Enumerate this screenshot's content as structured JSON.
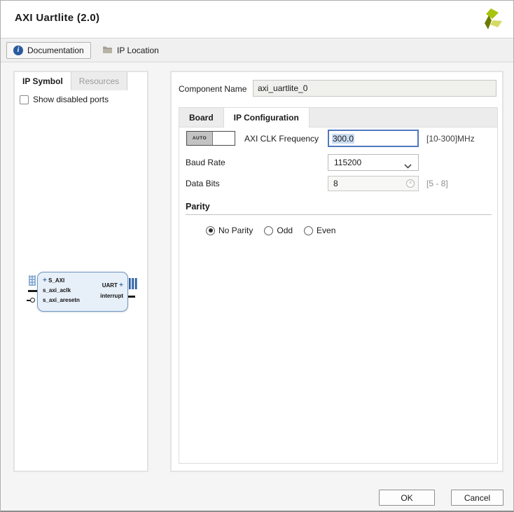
{
  "window": {
    "title": "AXI Uartlite (2.0)"
  },
  "toolbar": {
    "documentation_label": "Documentation",
    "ip_location_label": "IP Location",
    "icons": {
      "documentation": "info-circle-icon",
      "ip_location": "folder-icon"
    }
  },
  "left_panel": {
    "tabs": [
      {
        "label": "IP Symbol",
        "active": true
      },
      {
        "label": "Resources",
        "active": false
      }
    ],
    "show_disabled_ports_label": "Show disabled ports",
    "show_disabled_ports_checked": false,
    "ip_symbol": {
      "plus_glyph": "+",
      "left_ports": [
        {
          "name": "S_AXI",
          "type": "interface"
        },
        {
          "name": "s_axi_aclk",
          "type": "clock"
        },
        {
          "name": "s_axi_aresetn",
          "type": "reset-active-low"
        }
      ],
      "right_ports": [
        {
          "name": "UART",
          "type": "interface"
        },
        {
          "name": "interrupt",
          "type": "signal"
        }
      ]
    }
  },
  "main": {
    "component_name": {
      "label": "Component Name",
      "value": "axi_uartlite_0"
    },
    "tabs": [
      {
        "label": "Board",
        "active": false
      },
      {
        "label": "IP Configuration",
        "active": true
      }
    ],
    "fields": {
      "axi_clk": {
        "auto_label": "AUTO",
        "label": "AXI CLK Frequency",
        "value": "300.0",
        "range": "[10-300]MHz"
      },
      "baud_rate": {
        "label": "Baud Rate",
        "value": "115200"
      },
      "data_bits": {
        "label": "Data Bits",
        "value": "8",
        "range": "[5 - 8]"
      }
    },
    "parity": {
      "heading": "Parity",
      "options": [
        {
          "label": "No Parity",
          "selected": true
        },
        {
          "label": "Odd",
          "selected": false
        },
        {
          "label": "Even",
          "selected": false
        }
      ]
    }
  },
  "footer": {
    "ok_label": "OK",
    "cancel_label": "Cancel"
  },
  "colors": {
    "focus_border": "#4f79bd",
    "selection_bg": "#cadcf2",
    "symbol_fill": "#e7eff8",
    "symbol_border": "#6f94bf",
    "info_icon_bg": "#2a5a9f",
    "logo_bright": "#a9c40e",
    "logo_dark": "#6d7a00",
    "logo_light": "#d5da64"
  }
}
